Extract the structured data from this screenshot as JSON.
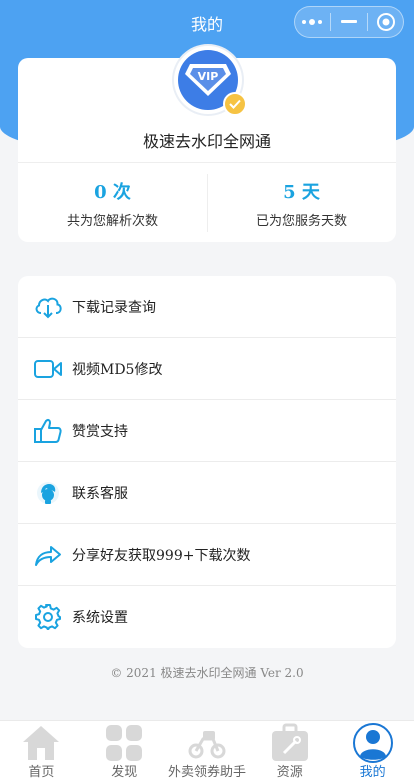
{
  "nav": {
    "title": "我的"
  },
  "profile": {
    "badge_text": "VIP",
    "app_name": "极速去水印全网通",
    "stats": [
      {
        "value": "0 次",
        "label": "共为您解析次数"
      },
      {
        "value": "5 天",
        "label": "已为您服务天数"
      }
    ]
  },
  "menu": {
    "items": [
      {
        "icon": "cloud-download-icon",
        "label": "下载记录查询"
      },
      {
        "icon": "video-camera-icon",
        "label": "视频MD5修改"
      },
      {
        "icon": "thumbs-up-icon",
        "label": "赞赏支持"
      },
      {
        "icon": "customer-service-icon",
        "label": "联系客服"
      },
      {
        "icon": "share-icon",
        "label": "分享好友获取999+下载次数"
      },
      {
        "icon": "settings-gear-icon",
        "label": "系统设置"
      }
    ]
  },
  "footer": {
    "copyright": "© 2021 极速去水印全网通 Ver 2.0"
  },
  "tabbar": {
    "tabs": [
      {
        "icon": "home-icon",
        "label": "首页",
        "active": false
      },
      {
        "icon": "discover-grid-icon",
        "label": "发现",
        "active": false
      },
      {
        "icon": "delivery-scooter-icon",
        "label": "外卖领券助手",
        "active": false
      },
      {
        "icon": "resources-toolbox-icon",
        "label": "资源",
        "active": false
      },
      {
        "icon": "user-profile-icon",
        "label": "我的",
        "active": true
      }
    ]
  },
  "colors": {
    "header_blue": "#4da2f2",
    "accent_cyan": "#1aa3e0",
    "active_tab": "#1a77d4",
    "verified_gold": "#f6c343"
  }
}
